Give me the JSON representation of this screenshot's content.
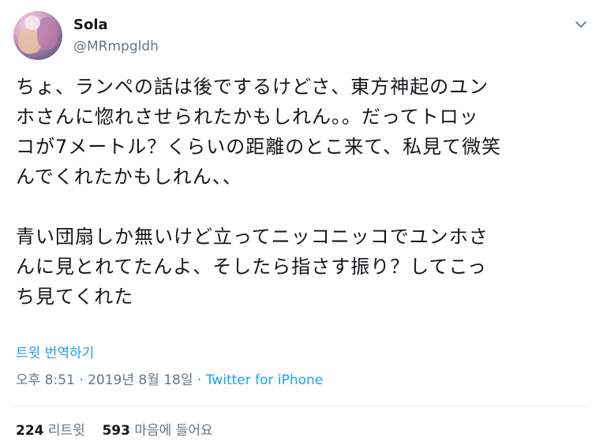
{
  "user": {
    "name": "Sola",
    "handle": "@MRmpgldh",
    "avatar_icon": "profile-avatar"
  },
  "menu_icon": "chevron-down-icon",
  "tweet": {
    "lines": [
      "ちょ、ランペの話は後でするけどさ、東方神起のユン",
      "ホさんに惚れさせられたかもしれん。。だってトロッ",
      "コが7メートル？くらいの距離のとこ来て、私見て微笑",
      "んでくれたかもしれん、、",
      "",
      "青い団扇しか無いけど立ってニッコニッコでユンホさ",
      "んに見とれてたんよ、そしたら指さす振り？してこっ",
      "ち見てくれた"
    ]
  },
  "translate_label": "트윗 번역하기",
  "meta": {
    "time": "오후 8:51",
    "separator": " · ",
    "date": "2019년 8월 18일",
    "source": "Twitter for iPhone"
  },
  "stats": {
    "retweets_count": "224",
    "retweets_label": "리트윗",
    "likes_count": "593",
    "likes_label": "마음에 들어요"
  },
  "colors": {
    "link": "#1da1f2",
    "secondary": "#657786",
    "primary": "#14171a",
    "divider": "#e6ecf0"
  }
}
